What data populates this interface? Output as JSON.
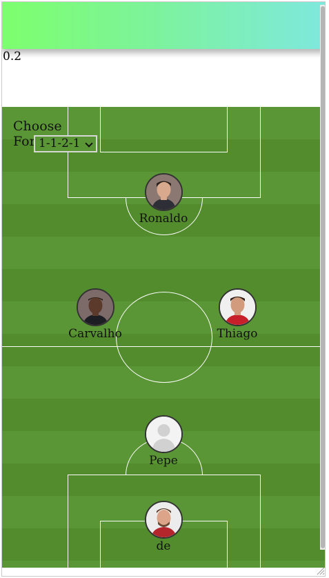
{
  "header": {
    "value_text": "0.2"
  },
  "formation": {
    "label": "Choose Formation",
    "selected": "1-1-2-1"
  },
  "players": {
    "forward": {
      "name": "Ronaldo",
      "icon": "player-photo-ronaldo"
    },
    "mid_left": {
      "name": "Carvalho",
      "icon": "player-photo-carvalho"
    },
    "mid_right": {
      "name": "Thiago",
      "icon": "player-photo-thiago"
    },
    "defender": {
      "name": "Pepe",
      "icon": "default-avatar-icon"
    },
    "goalkeeper": {
      "name": "de",
      "icon": "player-photo-de"
    }
  },
  "colors": {
    "pitch_light": "#5b9636",
    "pitch_dark": "#528c2d",
    "header_green": "#7dff6e",
    "header_cyan": "#7fe8de"
  }
}
